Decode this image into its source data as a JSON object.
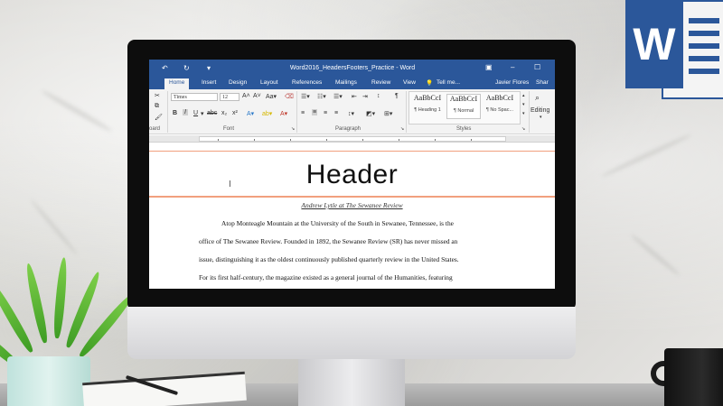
{
  "window": {
    "title": "Word2016_HeadersFooters_Practice - Word",
    "user": "Javier Flores",
    "share_label": "Shar"
  },
  "tabs": [
    {
      "label": "Home",
      "active": true
    },
    {
      "label": "Insert"
    },
    {
      "label": "Design"
    },
    {
      "label": "Layout"
    },
    {
      "label": "References"
    },
    {
      "label": "Mailings"
    },
    {
      "label": "Review"
    },
    {
      "label": "View"
    },
    {
      "label": "Tell me..."
    }
  ],
  "ribbon": {
    "font_name": "Times",
    "font_size": "12",
    "bold": "B",
    "italic": "I",
    "underline": "U",
    "font_group_label": "Font",
    "paragraph_group_label": "Paragraph",
    "styles_group_label": "Styles",
    "clipboard_group_label": "oard",
    "editing_label": "Editing",
    "styles": [
      {
        "sample": "AaBbCcI",
        "name": "¶ Heading 1"
      },
      {
        "sample": "AaBbCcI",
        "name": "¶ Normal"
      },
      {
        "sample": "AaBbCcI",
        "name": "¶ No Spac..."
      }
    ]
  },
  "document": {
    "header_text": "Header",
    "byline": "Andrew Lytle at The Sewanee Review",
    "lines": [
      "Atop Monteagle Mountain at the University of the South in Sewanee, Tennessee, is the",
      "office of The Sewanee Review. Founded in 1892, the Sewanee Review (SR) has never missed an",
      "issue, distinguishing it as the oldest continuously published quarterly review in the United States.",
      "For its first half-century, the magazine existed as a general journal of the Humanities, featuring"
    ]
  },
  "logo": {
    "letter": "W",
    "color": "#2b579a"
  },
  "colors": {
    "accent": "#2b579a",
    "header_border": "#f1a07e"
  }
}
